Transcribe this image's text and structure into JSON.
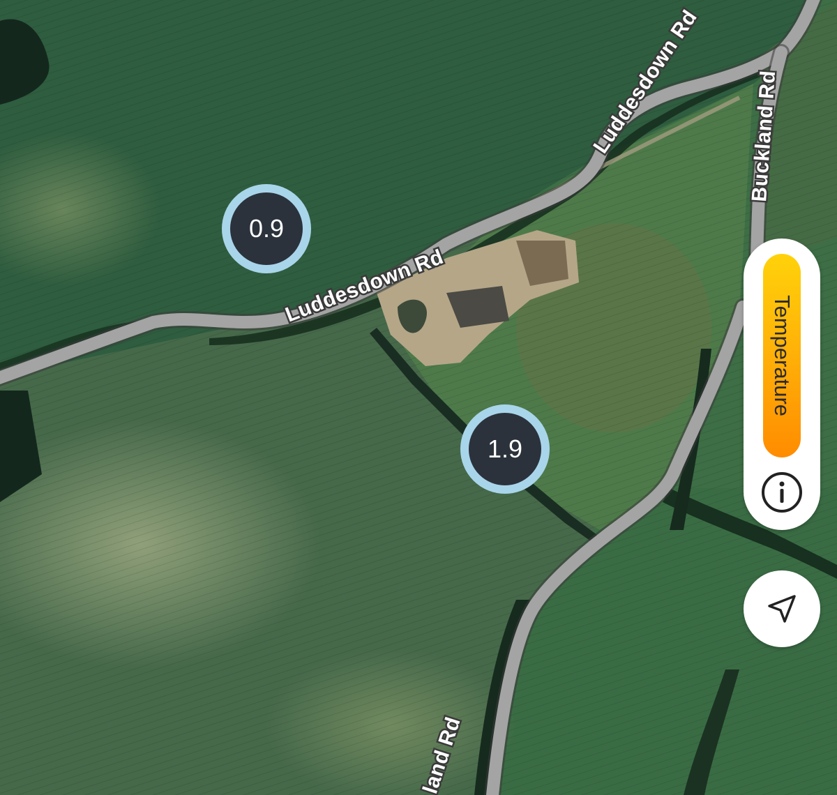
{
  "map": {
    "roads": [
      {
        "name": "Luddesdown Rd"
      },
      {
        "name": "Luddesdown Rd"
      },
      {
        "name": "Buckland Rd"
      },
      {
        "name": "land Rd"
      }
    ],
    "markers": [
      {
        "value": "0.9"
      },
      {
        "value": "1.9"
      }
    ]
  },
  "controls": {
    "layer_label": "Temperature",
    "layer_gradient": [
      "#ffd20a",
      "#ffb008",
      "#ff8c00"
    ],
    "info_icon": "info-circle-icon",
    "locate_icon": "navigation-arrow-icon"
  },
  "colors": {
    "marker_fill": "#2b323c",
    "marker_ring": "#a9d5ea",
    "road": "#a4a4a4"
  }
}
